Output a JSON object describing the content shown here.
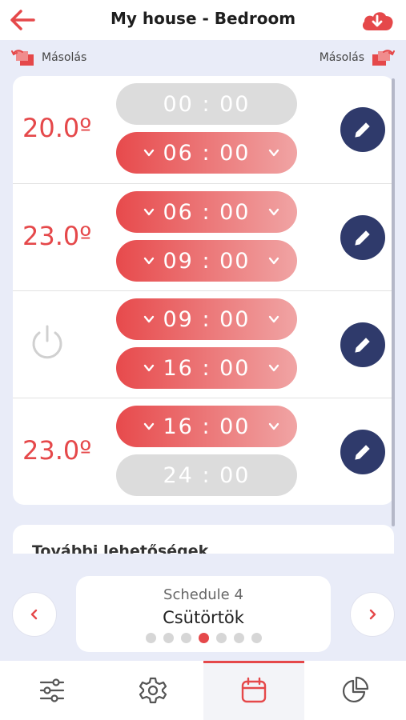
{
  "header": {
    "title": "My house - Bedroom"
  },
  "copy": {
    "left_label": "Másolás",
    "right_label": "Másolás"
  },
  "rows": [
    {
      "temp": "20.0º",
      "mode": "temp",
      "start": "00 : 00",
      "end": "06 : 00",
      "start_editable": false,
      "end_editable": true
    },
    {
      "temp": "23.0º",
      "mode": "temp",
      "start": "06 : 00",
      "end": "09 : 00",
      "start_editable": true,
      "end_editable": true
    },
    {
      "temp": "",
      "mode": "off",
      "start": "09 : 00",
      "end": "16 : 00",
      "start_editable": true,
      "end_editable": true
    },
    {
      "temp": "23.0º",
      "mode": "temp",
      "start": "16 : 00",
      "end": "24 : 00",
      "start_editable": true,
      "end_editable": false
    }
  ],
  "more": {
    "title": "További lehetőségek"
  },
  "schedule": {
    "name": "Schedule 4",
    "day": "Csütörtök",
    "page_count": 7,
    "active_page": 4
  },
  "tabs": [
    {
      "icon": "sliders-icon",
      "active": false
    },
    {
      "icon": "gear-icon",
      "active": false
    },
    {
      "icon": "calendar-icon",
      "active": true
    },
    {
      "icon": "pie-chart-icon",
      "active": false
    }
  ],
  "colors": {
    "accent": "#e5484a",
    "navy": "#2f3a6b",
    "background": "#e9ecf8"
  }
}
